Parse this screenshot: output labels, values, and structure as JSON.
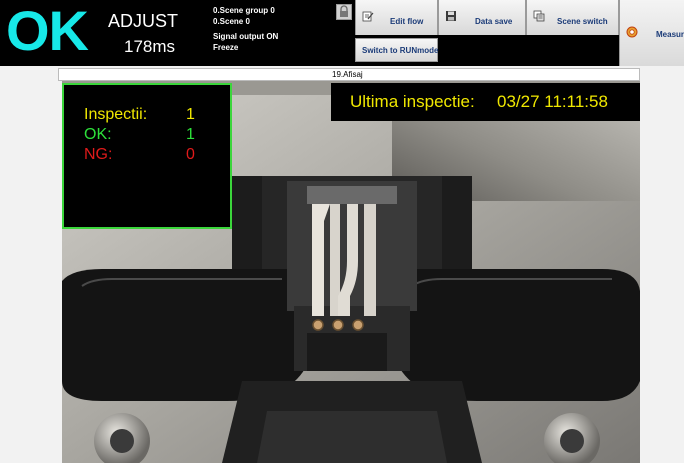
{
  "status": {
    "result": "OK",
    "mode": "ADJUST",
    "time": "178ms"
  },
  "info_lines": [
    "0.Scene group 0",
    "0.Scene 0",
    "Signal output ON",
    "Freeze"
  ],
  "toolbar": {
    "edit_flow": "Edit flow",
    "data_save": "Data save",
    "scene_switch": "Scene switch",
    "measure": "Measure",
    "run_mode": "Switch to RUNmode"
  },
  "icons": [
    "lock-icon",
    "edit-flow-icon",
    "data-save-icon",
    "scene-switch-icon",
    "measure-icon"
  ],
  "panel": {
    "title": "19.Afisaj"
  },
  "overlay": {
    "inspections_label": "Inspectii:",
    "inspections_value": "1",
    "ok_label": "OK:",
    "ok_value": "1",
    "ng_label": "NG:",
    "ng_value": "0",
    "last_label": "Ultima inspectie:",
    "last_value": "03/27 11:11:58"
  },
  "colors": {
    "ok_cyan": "#17e8e8",
    "inspections_yellow": "#f0e800",
    "ok_green": "#2de03a",
    "ng_red": "#e01a1a",
    "box_border_green": "#3bd63b",
    "button_text": "#1b3b78"
  }
}
